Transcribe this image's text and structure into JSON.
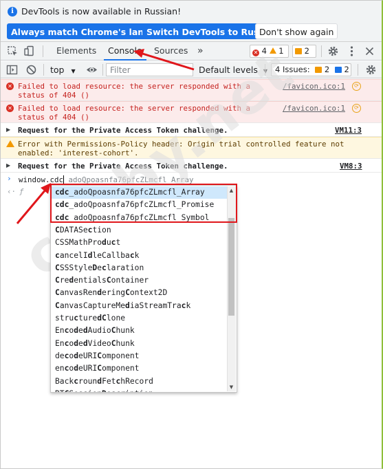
{
  "infobar": {
    "message": "DevTools is now available in Russian!",
    "buttons": [
      {
        "label": "Always match Chrome's language"
      },
      {
        "label": "Switch DevTools to Russian"
      },
      {
        "label": "Don't show again"
      }
    ]
  },
  "tabbar": {
    "tabs": [
      {
        "label": "Elements",
        "active": false
      },
      {
        "label": "Console",
        "active": true
      },
      {
        "label": "Sources",
        "active": false
      }
    ],
    "more": "»",
    "error_count": "4",
    "warning_count": "1",
    "issue_count": "2"
  },
  "console_toolbar": {
    "context": "top",
    "filter_placeholder": "Filter",
    "levels": "Default levels",
    "issues_label": "4 Issues:",
    "issues_warning": "2",
    "issues_info": "2"
  },
  "messages": [
    {
      "level": "error",
      "text": "Failed to load resource: the server responded with a\nstatus of 404 ()",
      "source": "/favicon.ico:1"
    },
    {
      "level": "error",
      "text": "Failed to load resource: the server responded with a\nstatus of 404 ()",
      "source": "/favicon.ico:1"
    },
    {
      "level": "info",
      "text": "Request for the Private Access Token challenge.",
      "source": "VM11:3"
    },
    {
      "level": "warning",
      "text": "Error with Permissions-Policy header: Origin trial controlled feature not\nenabled: 'interest-cohort'.",
      "source": ""
    },
    {
      "level": "info",
      "text": "Request for the Private Access Token challenge.",
      "source": "VM8:3"
    }
  ],
  "prompt": {
    "typed": "window.cdc",
    "ghost": "_adoQpoasnfa76pfcZLmcfl_Array",
    "result_prefix": "ƒ"
  },
  "suggestions": [
    {
      "match": "cdc",
      "rest": "_adoQpoasnfa76pfcZLmcfl_Array",
      "selected": true
    },
    {
      "match": "cdc",
      "rest": "_adoQpoasnfa76pfcZLmcfl_Promise",
      "selected": false
    },
    {
      "match": "cdc",
      "rest": "_adoQpoasnfa76pfcZLmcfl_Symbol",
      "selected": false
    },
    {
      "html": "<b>C</b>DATASe<b>c</b>tion"
    },
    {
      "html": "CSSMathPro<b>d</b>u<b>c</b>t"
    },
    {
      "html": "<b>c</b>ancelI<b>d</b>leCallba<b>c</b>k"
    },
    {
      "html": "<b>C</b>SSStyle<b>D</b>e<b>c</b>laration"
    },
    {
      "html": "<b>C</b>re<b>d</b>entials<b>C</b>ontainer"
    },
    {
      "html": "<b>C</b>anvasRen<b>d</b>ering<b>C</b>ontext2D"
    },
    {
      "html": "<b>C</b>anvasCaptureMe<b>d</b>iaStreamTra<b>c</b>k"
    },
    {
      "html": "stru<b>c</b>ture<b>dC</b>lone"
    },
    {
      "html": "En<b>c</b>o<b>d</b>e<b>d</b>Audio<b>C</b>hunk"
    },
    {
      "html": "En<b>c</b>o<b>d</b>e<b>d</b>Video<b>C</b>hunk"
    },
    {
      "html": "de<b>c</b>o<b>d</b>eURI<b>C</b>omponent"
    },
    {
      "html": "en<b>c</b>o<b>d</b>eURI<b>C</b>omponent"
    },
    {
      "html": "Back<b>c</b>roun<b>d</b>Fet<b>c</b>hRecord"
    },
    {
      "html": "RT<b>C</b>Session<b>D</b>escription"
    }
  ],
  "watermark": "cdeby.net",
  "colors": {
    "accent": "#1a73e8",
    "error": "#d93025",
    "warning": "#f29900",
    "highlight_box": "#e0161b"
  }
}
